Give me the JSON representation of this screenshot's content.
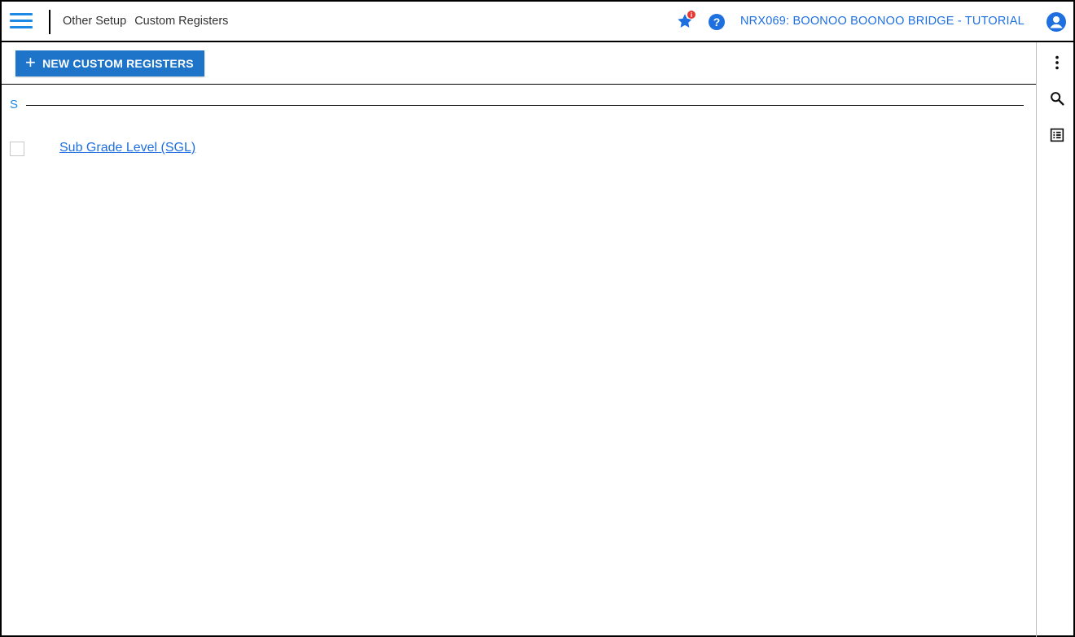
{
  "header": {
    "breadcrumb": [
      "Other Setup",
      "Custom Registers"
    ],
    "favorites_badge": "i",
    "help_symbol": "?",
    "org_title": "NRX069: BOONOO BOONOO BRIDGE - TUTORIAL"
  },
  "toolbar": {
    "new_button_label": "NEW CUSTOM REGISTERS",
    "new_button_icon": "+"
  },
  "groups": [
    {
      "letter": "S",
      "items": [
        {
          "label": "Sub Grade Level (SGL)",
          "checked": false
        }
      ]
    }
  ],
  "colors": {
    "accent": "#1e88e5",
    "button": "#1e74c8",
    "link": "#1e6fe0",
    "badge": "#e53935"
  },
  "icons": [
    "hamburger-menu-icon",
    "favorites-star-icon",
    "help-icon",
    "user-account-icon",
    "more-vertical-icon",
    "search-icon",
    "list-view-icon"
  ]
}
